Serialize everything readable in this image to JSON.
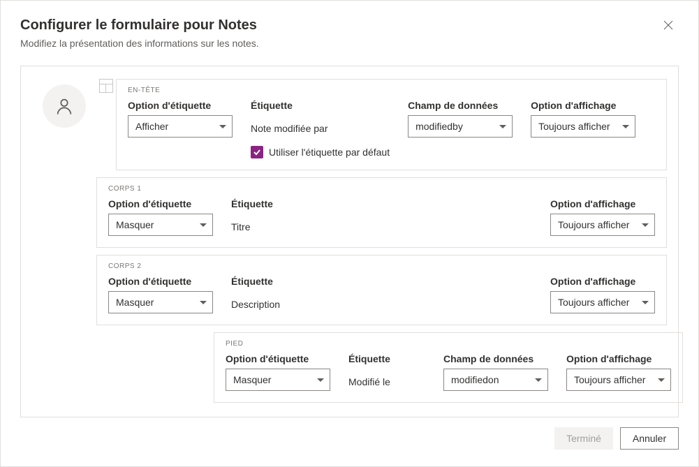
{
  "dialog": {
    "title": "Configurer le formulaire pour Notes",
    "subtitle": "Modifiez la présentation des informations sur les notes."
  },
  "labels": {
    "label_option": "Option d'étiquette",
    "label": "Étiquette",
    "data_field": "Champ de données",
    "display_option": "Option d'affichage",
    "use_default_label": "Utiliser l'étiquette par défaut"
  },
  "sections": {
    "header": {
      "section_name": "EN-TÊTE",
      "label_option_value": "Afficher",
      "label_value": "Note modifiée par",
      "data_field_value": "modifiedby",
      "display_option_value": "Toujours afficher",
      "use_default_checked": true
    },
    "body1": {
      "section_name": "CORPS 1",
      "label_option_value": "Masquer",
      "label_value": "Titre",
      "display_option_value": "Toujours afficher"
    },
    "body2": {
      "section_name": "CORPS 2",
      "label_option_value": "Masquer",
      "label_value": "Description",
      "display_option_value": "Toujours afficher"
    },
    "footer": {
      "section_name": "PIED",
      "label_option_value": "Masquer",
      "label_value": "Modifié le",
      "data_field_value": "modifiedon",
      "display_option_value": "Toujours afficher"
    }
  },
  "actions": {
    "done": "Terminé",
    "cancel": "Annuler"
  }
}
